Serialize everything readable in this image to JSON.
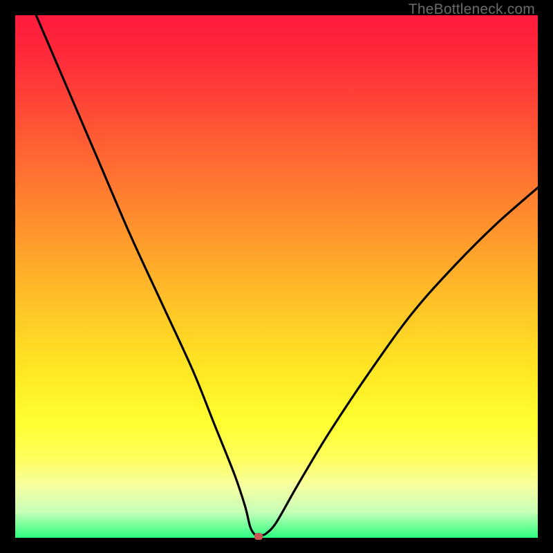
{
  "watermark": "TheBottleneck.com",
  "chart_data": {
    "type": "line",
    "title": "",
    "xlabel": "",
    "ylabel": "",
    "xlim": [
      0,
      100
    ],
    "ylim": [
      0,
      100
    ],
    "grid": false,
    "series": [
      {
        "name": "bottleneck-curve",
        "x": [
          4,
          10,
          16,
          22,
          28,
          34,
          38,
          42,
          44,
          45,
          46,
          47,
          48,
          50,
          54,
          60,
          68,
          76,
          84,
          92,
          100
        ],
        "y": [
          100,
          86,
          72,
          58,
          45,
          32,
          22,
          12,
          6,
          2,
          0.5,
          0.5,
          0.8,
          3,
          10,
          20,
          32,
          43,
          52,
          60,
          67
        ]
      }
    ],
    "annotations": [
      {
        "name": "minimum-marker",
        "x": 46.5,
        "y": 0.3
      }
    ],
    "background_gradient": {
      "top": "#ff1a3c",
      "mid": "#ffe724",
      "bottom": "#2bff81"
    }
  }
}
